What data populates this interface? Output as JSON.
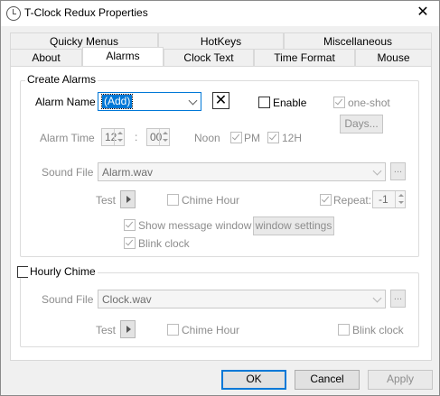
{
  "window": {
    "title": "T-Clock Redux Properties",
    "close_glyph": "✕"
  },
  "tabs": {
    "row1": [
      "Quicky Menus",
      "HotKeys",
      "Miscellaneous"
    ],
    "row2": [
      "About",
      "Alarms",
      "Clock Text",
      "Time Format",
      "Mouse"
    ],
    "active": "Alarms"
  },
  "create_alarms": {
    "group_label": "Create Alarms",
    "alarm_name_label": "Alarm Name",
    "alarm_name_value": "(Add)",
    "delete_glyph": "✕",
    "enable_label": "Enable",
    "enable_checked": false,
    "oneshot_label": "one-shot",
    "oneshot_checked": true,
    "days_button": "Days...",
    "alarm_time_label": "Alarm Time",
    "hour": "12",
    "time_sep": ":",
    "minute": "00",
    "noon_label": "Noon",
    "pm_label": "PM",
    "pm_checked": true,
    "h12_label": "12H",
    "h12_checked": true,
    "sound_file_label": "Sound File",
    "sound_file_value": "Alarm.wav",
    "browse_label": "...",
    "test_label": "Test",
    "chime_hour_label": "Chime Hour",
    "chime_hour_checked": false,
    "repeat_label": "Repeat:",
    "repeat_checked": true,
    "repeat_value": "-1",
    "show_message_label": "Show message window",
    "show_message_checked": true,
    "window_settings_button": "window settings",
    "blink_clock_label": "Blink clock",
    "blink_clock_checked": true
  },
  "hourly_chime": {
    "group_label": "Hourly Chime",
    "checked": false,
    "sound_file_label": "Sound File",
    "sound_file_value": "Clock.wav",
    "browse_label": "...",
    "test_label": "Test",
    "chime_hour_label": "Chime Hour",
    "chime_hour_checked": false,
    "blink_clock_label": "Blink clock",
    "blink_clock_checked": false
  },
  "footer": {
    "ok": "OK",
    "cancel": "Cancel",
    "apply": "Apply"
  },
  "colors": {
    "accent": "#0078d7",
    "disabled_text": "#8d8d8d"
  }
}
